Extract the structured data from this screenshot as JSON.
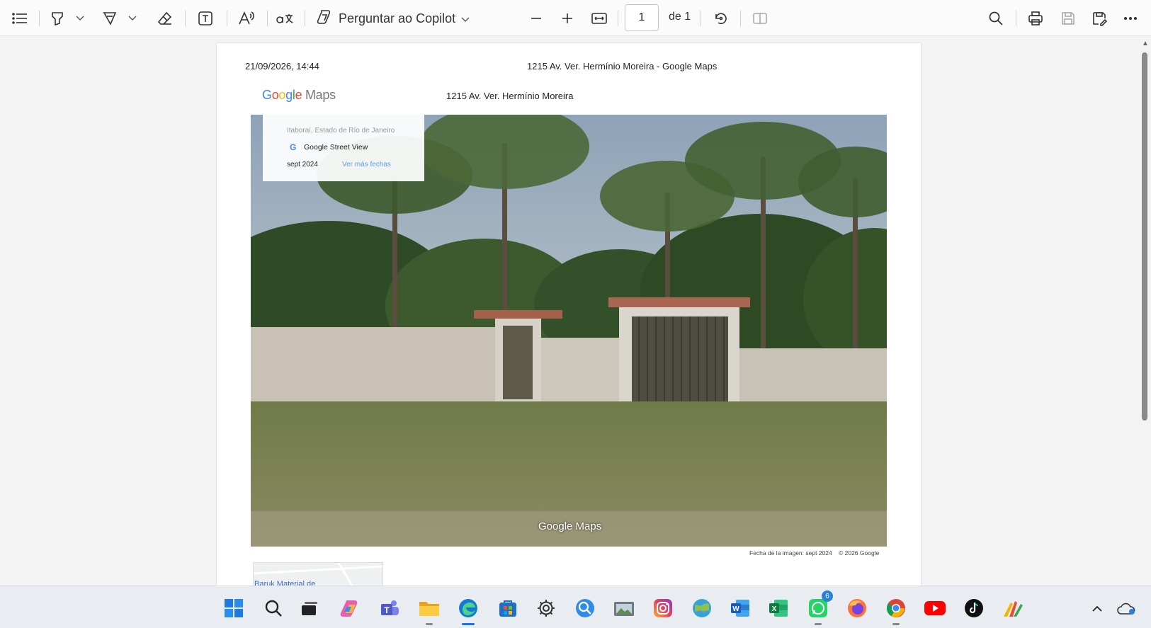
{
  "toolbar": {
    "copilot_label": "Perguntar ao Copilot",
    "page_current": "1",
    "page_of": "de 1",
    "icons": [
      "table-of-contents-icon",
      "highlight-icon",
      "draw-icon",
      "eraser-icon",
      "text-box-icon",
      "read-aloud-icon",
      "translate-icon",
      "copilot-icon",
      "zoom-out-icon",
      "zoom-in-icon",
      "fit-width-icon",
      "rotate-icon",
      "page-view-icon",
      "search-icon",
      "print-icon",
      "save-icon",
      "save-as-icon",
      "more-icon"
    ]
  },
  "document": {
    "header_date": "21/09/2026, 14:44",
    "header_title": "1215 Av. Ver. Hermínio Moreira - Google Maps",
    "logo_text": "Google Maps",
    "address": "1215 Av. Ver. Hermínio Moreira",
    "streetview": {
      "location": "Itaboraí, Estado de Río de Janeiro",
      "brand": "Google Street View",
      "date": "sept 2024",
      "more_dates": "Ver más fechas"
    },
    "watermark": "Google Maps",
    "image_date": "Fecha de la imagen: sept 2024",
    "copyright": "© 2026 Google",
    "minimap_label": "Baruk Material de"
  },
  "taskbar": {
    "apps": [
      {
        "name": "start-icon"
      },
      {
        "name": "search-icon"
      },
      {
        "name": "task-view-icon"
      },
      {
        "name": "copilot-app-icon"
      },
      {
        "name": "teams-icon"
      },
      {
        "name": "file-explorer-icon"
      },
      {
        "name": "edge-icon"
      },
      {
        "name": "store-icon"
      },
      {
        "name": "settings-icon"
      },
      {
        "name": "quick-assist-icon"
      },
      {
        "name": "photos-icon"
      },
      {
        "name": "instagram-icon"
      },
      {
        "name": "maps-icon"
      },
      {
        "name": "word-icon"
      },
      {
        "name": "excel-icon"
      },
      {
        "name": "whatsapp-icon",
        "badge": "6"
      },
      {
        "name": "firefox-icon"
      },
      {
        "name": "chrome-icon"
      },
      {
        "name": "youtube-icon"
      },
      {
        "name": "tiktok-icon"
      },
      {
        "name": "paint-icon"
      }
    ]
  }
}
